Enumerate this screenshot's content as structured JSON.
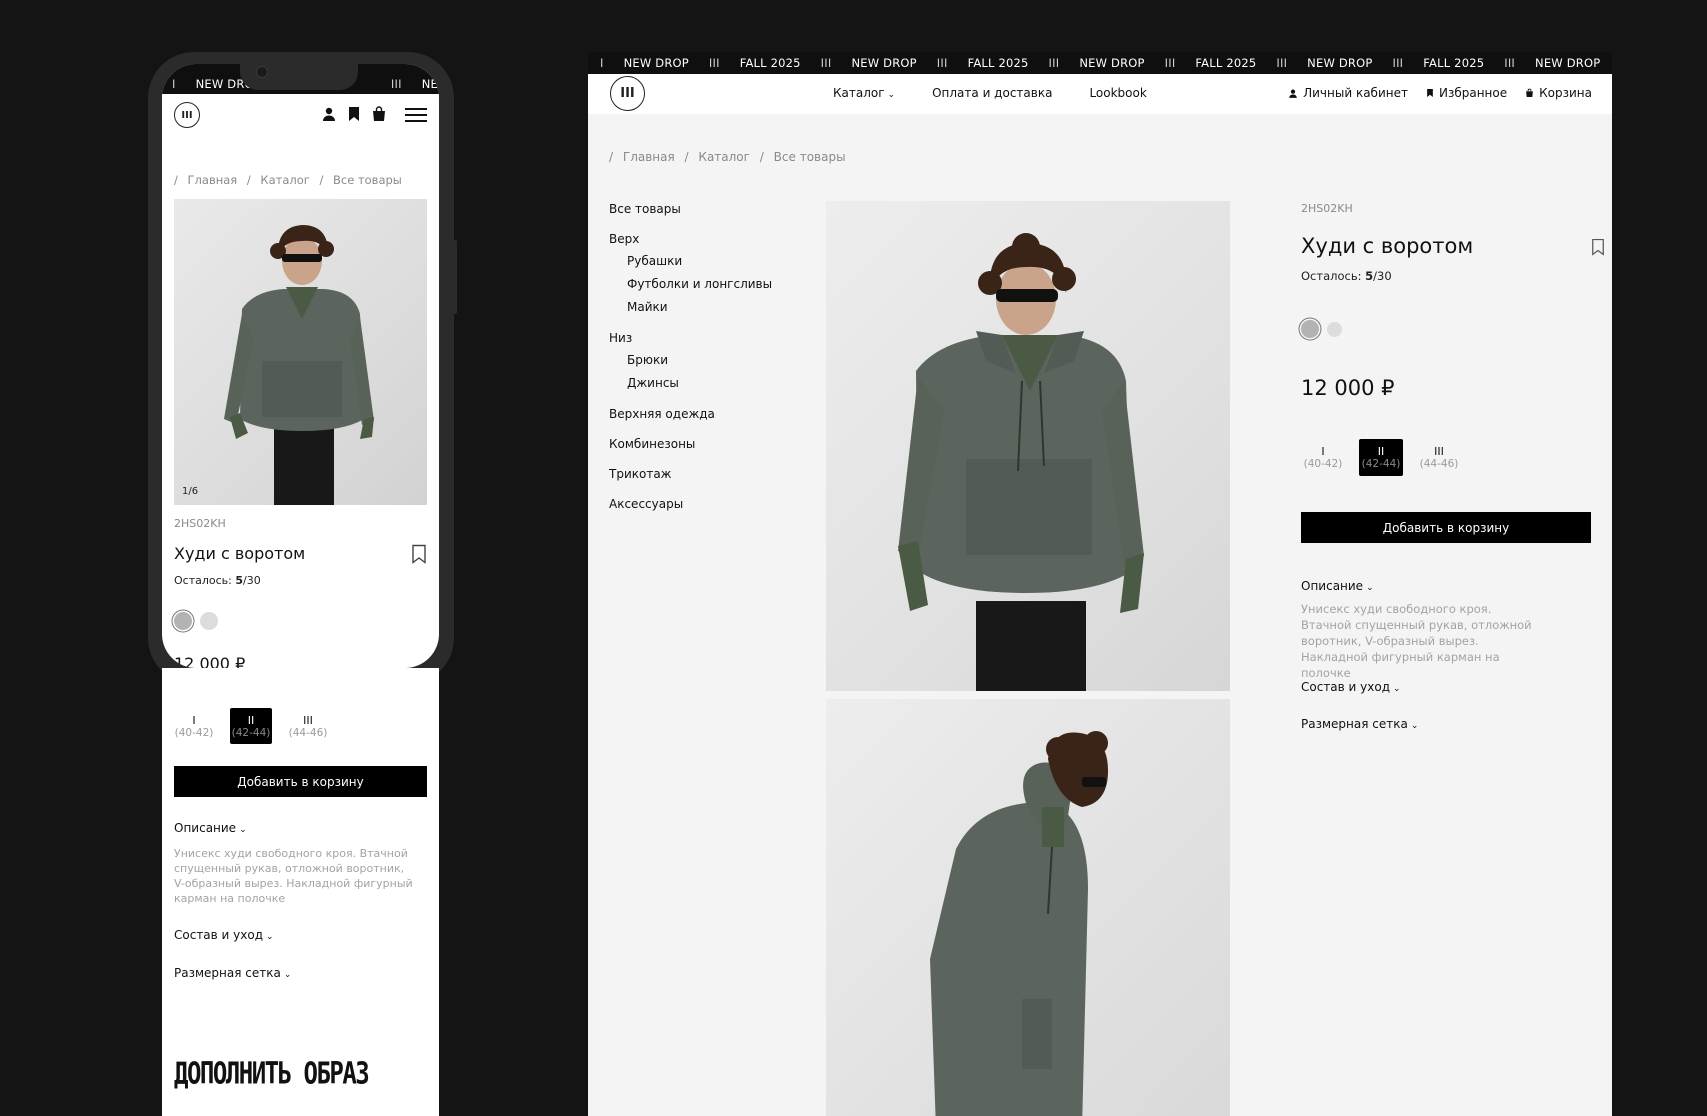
{
  "ticker": {
    "sep_left": "I",
    "a": "NEW DROP",
    "sep": "III",
    "b": "FALL 2025",
    "mobile_partial_1": "NEW DROP",
    "mobile_partial_2": "NEW D"
  },
  "brand": {
    "logo_glyph": "III"
  },
  "header": {
    "nav": [
      "Каталог",
      "Оплата и доставка",
      "Lookbook"
    ],
    "account": "Личный кабинет",
    "favorites": "Избранное",
    "cart": "Корзина"
  },
  "breadcrumbs": [
    "Главная",
    "Каталог",
    "Все товары"
  ],
  "breadcrumb_sep": "/",
  "sidebar": {
    "all": "Все товары",
    "top": "Верх",
    "top_items": [
      "Рубашки",
      "Футболки и лонгсливы",
      "Майки"
    ],
    "bottom": "Низ",
    "bottom_items": [
      "Брюки",
      "Джинсы"
    ],
    "outerwear": "Верхняя одежда",
    "overalls": "Комбинезоны",
    "knitwear": "Трикотаж",
    "accessories": "Аксессуары"
  },
  "product": {
    "sku": "2HS02KH",
    "title": "Худи с воротом",
    "stock_label": "Осталось: ",
    "stock_left": "5",
    "stock_total": "/30",
    "price": "12 000 ₽",
    "photo_counter": "1/6",
    "colors": [
      "#b3b3b3",
      "#dcdcdc"
    ],
    "selected_color": 0,
    "sizes": [
      {
        "label": "I",
        "range": "(40-42)"
      },
      {
        "label": "II",
        "range": "(42-44)"
      },
      {
        "label": "III",
        "range": "(44-46)"
      }
    ],
    "selected_size": 1,
    "add_to_cart": "Добавить в корзину",
    "description_title": "Описание",
    "description": "Унисекс худи свободного кроя. Втачной спущенный рукав, отложной воротник, V-образный вырез. Накладной фигурный карман на полочке",
    "composition_title": "Состав и уход",
    "size_chart_title": "Размерная сетка"
  },
  "mobile": {
    "complete_look": "ДОПОЛНИТЬ ОБРАЗ"
  },
  "icons": {
    "chevron": "⌄",
    "user": "user-icon",
    "bookmark": "bookmark-icon",
    "bag": "bag-icon",
    "menu": "menu-icon"
  },
  "colors": {
    "background": "#141414",
    "ticker_bg": "#0f0f0f",
    "button_bg": "#000000",
    "muted_text": "#8a8a8a",
    "description_text": "#a3a3a3"
  }
}
